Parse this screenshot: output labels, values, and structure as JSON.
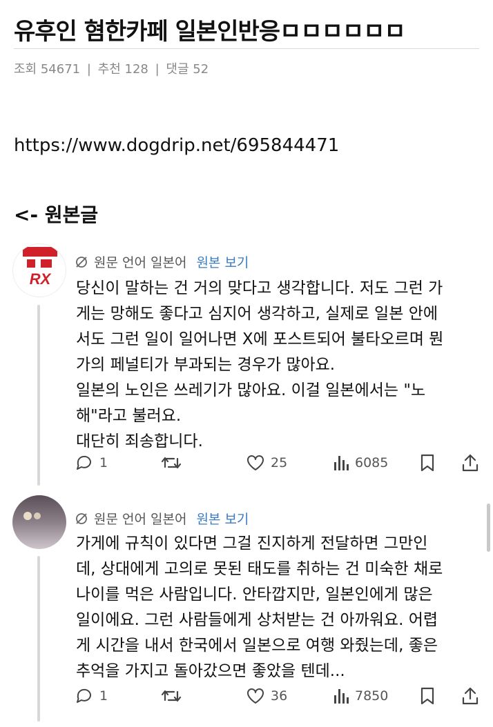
{
  "post": {
    "title": "유후인 혐한카페 일본인반응ㅁㅁㅁㅁㅁㅁ",
    "meta": {
      "views_label": "조회 54671",
      "likes_label": "추천 128",
      "comments_label": "댓글 52",
      "separator": "|"
    },
    "link": "https://www.dogdrip.net/695844471",
    "back_label": "<- 원본글"
  },
  "tweets": [
    {
      "avatar_text": "RX",
      "translate_label": "원문 언어 일본어",
      "original_link": "원본 보기",
      "lines": [
        "당신이 말하는 건 거의 맞다고 생각합니다. 저도 그런 가",
        "게는 망해도 좋다고 심지어 생각하고, 실제로 일본 안에",
        "서도 그런 일이 일어나면 X에 포스트되어 불타오르며 뭔",
        "가의 페널티가 부과되는 경우가 많아요.",
        "일본의 노인은 쓰레기가 많아요. 이걸 일본에서는 \"노",
        "해\"라고 불러요.",
        "대단히 죄송합니다."
      ],
      "replies": "1",
      "retweets": "",
      "likes": "25",
      "views": "6085"
    },
    {
      "avatar_text": "",
      "translate_label": "원문 언어 일본어",
      "original_link": "원본 보기",
      "lines": [
        "가게에 규칙이 있다면 그걸 진지하게 전달하면 그만인",
        "데, 상대에게 고의로 못된 태도를 취하는 건 미숙한 채로",
        "나이를 먹은 사람입니다. 안타깝지만, 일본인에게 많은",
        "일이에요. 그런 사람들에게 상처받는 건 아까워요. 어렵",
        "게 시간을 내서 한국에서 일본으로 여행 와줬는데, 좋은",
        "추억을 가지고 돌아갔으면 좋았을 텐데..."
      ],
      "replies": "1",
      "retweets": "",
      "likes": "36",
      "views": "7850"
    }
  ],
  "colors": {
    "text": "#111111",
    "muted": "#555555",
    "meta": "#888888",
    "link_blue": "#3a7bbf",
    "divider": "#d9d9d9",
    "rx_red": "#d0202a"
  },
  "icons": [
    "translate-icon",
    "reply-icon",
    "retweet-icon",
    "like-icon",
    "views-icon",
    "bookmark-icon",
    "share-icon"
  ]
}
